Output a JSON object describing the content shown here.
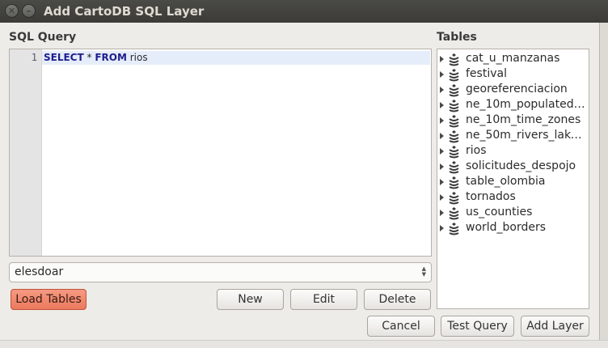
{
  "window": {
    "title": "Add CartoDB SQL Layer"
  },
  "sql": {
    "label": "SQL Query",
    "line_number": "1",
    "keyword_select": "SELECT",
    "star": " * ",
    "keyword_from": "FROM",
    "table": " rios"
  },
  "connection": {
    "selected": "elesdoar"
  },
  "buttons": {
    "load_tables": "Load Tables",
    "new": "New",
    "edit": "Edit",
    "delete": "Delete",
    "cancel": "Cancel",
    "test_query": "Test Query",
    "add_layer": "Add Layer"
  },
  "tables": {
    "label": "Tables",
    "items": [
      "cat_u_manzanas",
      "festival",
      "georeferenciacion",
      "ne_10m_populated…",
      "ne_10m_time_zones",
      "ne_50m_rivers_lake…",
      "rios",
      "solicitudes_despojo",
      "table_olombia",
      "tornados",
      "us_counties",
      "world_borders"
    ]
  },
  "icons": {
    "table_icon": "database-icon",
    "expand_icon": "expand-triangle-icon"
  },
  "colors": {
    "accent": "#eb7a5e",
    "titlebar": "#3c3b37",
    "keyword": "#1e1e8c"
  }
}
